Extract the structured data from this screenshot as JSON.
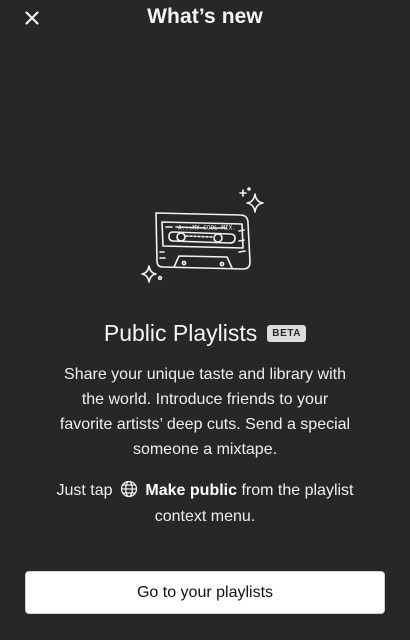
{
  "header": {
    "title": "What’s new",
    "close_icon": "close-icon"
  },
  "hero": {
    "icon": "cassette-tape-illustration",
    "tape_label": "A...MY COOL MIX."
  },
  "feature": {
    "title": "Public Playlists",
    "badge": "BETA",
    "description": "Share your unique taste and library with the world. Introduce friends to your favorite artists’ deep cuts. Send a special someone a mixtape.",
    "hint_prefix": "Just tap",
    "hint_icon": "globe-icon",
    "hint_action": "Make public",
    "hint_suffix": "from the playlist context menu."
  },
  "cta": {
    "label": "Go to your playlists"
  },
  "colors": {
    "background": "#262828",
    "text": "#f2f2f2",
    "button_bg": "#ffffff",
    "button_text": "#111111",
    "badge_bg": "#dcdcdc"
  }
}
